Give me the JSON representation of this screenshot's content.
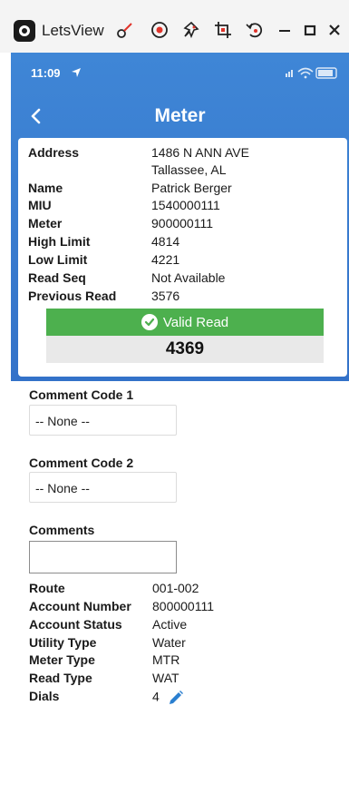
{
  "host_window": {
    "title": "LetsView",
    "tools": [
      "brush-icon",
      "record-icon",
      "pin-icon",
      "crop-icon",
      "rotate-icon",
      "minimize-icon",
      "maximize-icon",
      "close-icon"
    ]
  },
  "status_bar": {
    "time": "11:09"
  },
  "nav": {
    "title": "Meter",
    "back_icon": "chevron-left-icon"
  },
  "meter_info": {
    "rows": [
      {
        "label": "Address",
        "value": "1486 N ANN AVE",
        "value2": "Tallassee, AL"
      },
      {
        "label": "Name",
        "value": "Patrick Berger"
      },
      {
        "label": "MIU",
        "value": "1540000111"
      },
      {
        "label": "Meter",
        "value": "900000111"
      },
      {
        "label": "High Limit",
        "value": "4814"
      },
      {
        "label": "Low Limit",
        "value": "4221"
      },
      {
        "label": "Read Seq",
        "value": "Not Available"
      },
      {
        "label": "Previous Read",
        "value": "3576"
      }
    ],
    "status_text": "Valid Read",
    "status_color": "#4db04e",
    "current_read": "4369"
  },
  "form": {
    "comment_code_1": {
      "label": "Comment Code 1",
      "value": "-- None --"
    },
    "comment_code_2": {
      "label": "Comment Code 2",
      "value": "-- None --"
    },
    "comments": {
      "label": "Comments",
      "value": ""
    }
  },
  "account": {
    "rows": [
      {
        "label": "Route",
        "value": "001-002"
      },
      {
        "label": "Account Number",
        "value": "800000111"
      },
      {
        "label": "Account Status",
        "value": "Active"
      },
      {
        "label": "Utility Type",
        "value": "Water"
      },
      {
        "label": "Meter Type",
        "value": "MTR"
      },
      {
        "label": "Read Type",
        "value": "WAT"
      },
      {
        "label": "Dials",
        "value": "4"
      }
    ]
  },
  "colors": {
    "header_blue": "#3f86d6",
    "edit_blue": "#2a7fd0"
  }
}
